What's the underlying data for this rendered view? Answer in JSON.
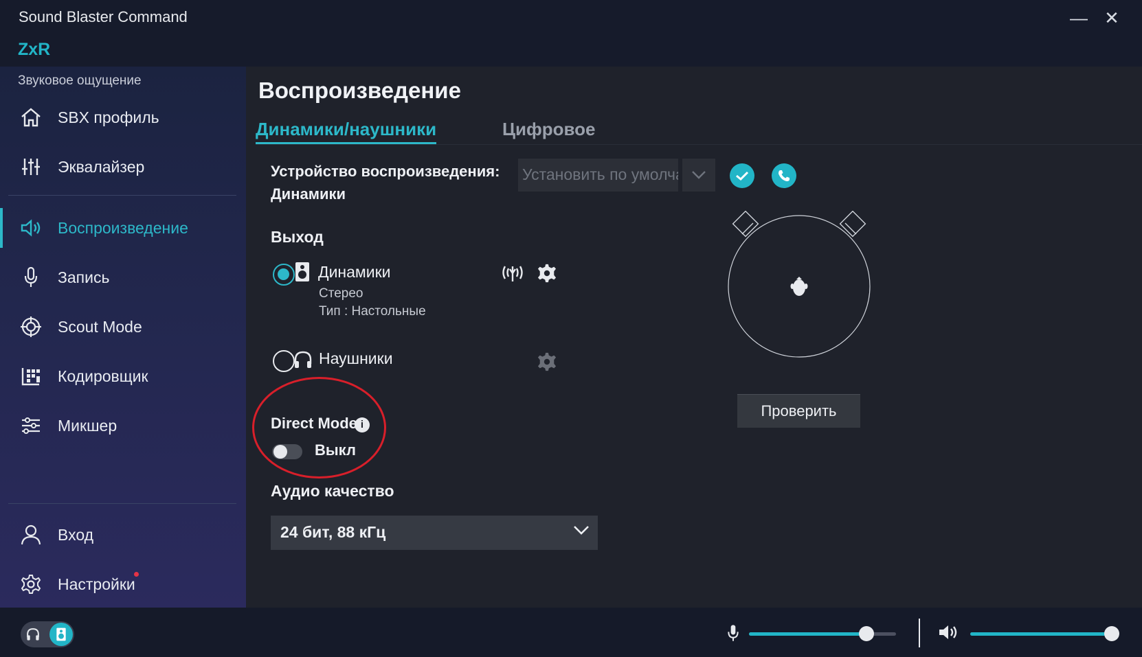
{
  "window": {
    "title": "Sound Blaster Command",
    "device": "ZxR",
    "minimize": "—",
    "close": "✕"
  },
  "sidebar": {
    "section_label": "Звуковое ощущение",
    "items": [
      {
        "label": "SBX профиль",
        "icon": "home-icon"
      },
      {
        "label": "Эквалайзер",
        "icon": "equalizer-icon"
      },
      {
        "label": "Воспроизведение",
        "icon": "speaker-icon",
        "active": true
      },
      {
        "label": "Запись",
        "icon": "microphone-icon"
      },
      {
        "label": "Scout Mode",
        "icon": "crosshair-icon"
      },
      {
        "label": "Кодировщик",
        "icon": "encoder-icon"
      },
      {
        "label": "Микшер",
        "icon": "mixer-icon"
      }
    ],
    "bottom_items": [
      {
        "label": "Вход",
        "icon": "user-icon"
      },
      {
        "label": "Настройки",
        "icon": "gear-icon"
      }
    ]
  },
  "main": {
    "title": "Воспроизведение",
    "tabs": [
      {
        "label": "Динамики/наушники",
        "active": true
      },
      {
        "label": "Цифровое",
        "active": false
      }
    ],
    "playback_device": {
      "label_line1": "Устройство воспроизведения:",
      "label_line2": "Динамики",
      "default_select": "Установить по умолчан"
    },
    "output": {
      "label": "Выход",
      "speakers": {
        "name": "Динамики",
        "line1": "Стерео",
        "line2": "Тип : Настольные",
        "selected": true
      },
      "headphones": {
        "name": "Наушники",
        "selected": false
      }
    },
    "direct_mode": {
      "label": "Direct Mode",
      "info": "i",
      "state_label": "Выкл",
      "on": false
    },
    "audio_quality": {
      "label": "Аудио качество",
      "value": "24 бит, 88 кГц"
    },
    "test_button": "Проверить"
  },
  "bottom": {
    "mic_level": 0.8,
    "speaker_level": 1.0
  },
  "colors": {
    "accent": "#22b5c7",
    "highlight": "#d81f2a"
  }
}
